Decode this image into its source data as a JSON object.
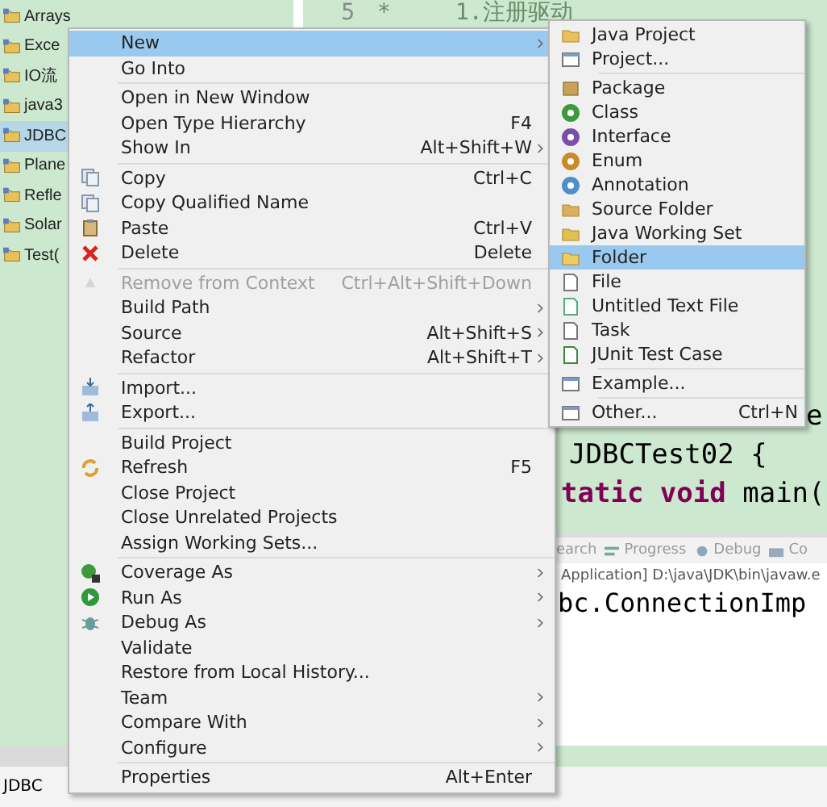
{
  "explorer": {
    "items": [
      {
        "label": "Arrays",
        "selected": false
      },
      {
        "label": "Exce",
        "selected": false
      },
      {
        "label": "IO流",
        "selected": false
      },
      {
        "label": "java3",
        "selected": false
      },
      {
        "label": "JDBC",
        "selected": true
      },
      {
        "label": "Plane",
        "selected": false
      },
      {
        "label": "Refle",
        "selected": false
      },
      {
        "label": "Solar",
        "selected": false
      },
      {
        "label": "Test(",
        "selected": false
      }
    ]
  },
  "editor": {
    "lines": [
      {
        "number": "5",
        "segments": [
          {
            "text": "*",
            "kind": "comment"
          },
          {
            "text": "1.注册驱动",
            "kind": "comment"
          }
        ]
      },
      {
        "segments": [
          {
            "text": "e",
            "kind": "plain"
          }
        ]
      },
      {
        "segments": [
          {
            "text": "JDBCTest02 {",
            "kind": "plain"
          }
        ]
      },
      {
        "segments": [
          {
            "text": "tatic void",
            "kind": "keyword"
          },
          {
            "text": " main(",
            "kind": "plain"
          }
        ]
      }
    ]
  },
  "console": {
    "tabs": [
      {
        "label": "earch",
        "kind": "search"
      },
      {
        "label": "Progress",
        "kind": "progress"
      },
      {
        "label": "Debug",
        "kind": "debug"
      },
      {
        "label": "Co",
        "kind": "console"
      }
    ],
    "header": "Application] D:\\java\\JDK\\bin\\javaw.e",
    "output": "bc.ConnectionImp"
  },
  "status_bar": {
    "text": "JDBC"
  },
  "context_menu": {
    "groups": [
      [
        {
          "label": "New",
          "selected": true,
          "submenu": true,
          "disabled": false
        },
        {
          "label": "Go Into",
          "selected": false,
          "submenu": false,
          "disabled": false
        }
      ],
      [
        {
          "label": "Open in New Window",
          "selected": false,
          "submenu": false,
          "disabled": false
        },
        {
          "label": "Open Type Hierarchy",
          "shortcut": "F4",
          "selected": false,
          "submenu": false,
          "disabled": false
        },
        {
          "label": "Show In",
          "shortcut": "Alt+Shift+W",
          "selected": false,
          "submenu": true,
          "disabled": false
        }
      ],
      [
        {
          "label": "Copy",
          "shortcut": "Ctrl+C",
          "kind": "copy",
          "selected": false,
          "submenu": false,
          "disabled": false
        },
        {
          "label": "Copy Qualified Name",
          "kind": "copy",
          "selected": false,
          "submenu": false,
          "disabled": false
        },
        {
          "label": "Paste",
          "shortcut": "Ctrl+V",
          "kind": "paste",
          "selected": false,
          "submenu": false,
          "disabled": false
        },
        {
          "label": "Delete",
          "shortcut": "Delete",
          "kind": "delete",
          "selected": false,
          "submenu": false,
          "disabled": false
        }
      ],
      [
        {
          "label": "Remove from Context",
          "shortcut": "Ctrl+Alt+Shift+Down",
          "kind": "remove",
          "selected": false,
          "submenu": false,
          "disabled": true
        },
        {
          "label": "Build Path",
          "selected": false,
          "submenu": true,
          "disabled": false
        },
        {
          "label": "Source",
          "shortcut": "Alt+Shift+S",
          "selected": false,
          "submenu": true,
          "disabled": false
        },
        {
          "label": "Refactor",
          "shortcut": "Alt+Shift+T",
          "selected": false,
          "submenu": true,
          "disabled": false
        }
      ],
      [
        {
          "label": "Import...",
          "kind": "import",
          "selected": false,
          "submenu": false,
          "disabled": false
        },
        {
          "label": "Export...",
          "kind": "export",
          "selected": false,
          "submenu": false,
          "disabled": false
        }
      ],
      [
        {
          "label": "Build Project",
          "selected": false,
          "submenu": false,
          "disabled": false
        },
        {
          "label": "Refresh",
          "shortcut": "F5",
          "kind": "refresh",
          "selected": false,
          "submenu": false,
          "disabled": false
        },
        {
          "label": "Close Project",
          "selected": false,
          "submenu": false,
          "disabled": false
        },
        {
          "label": "Close Unrelated Projects",
          "selected": false,
          "submenu": false,
          "disabled": false
        },
        {
          "label": "Assign Working Sets...",
          "selected": false,
          "submenu": false,
          "disabled": false
        }
      ],
      [
        {
          "label": "Coverage As",
          "kind": "coverage",
          "selected": false,
          "submenu": true,
          "disabled": false
        },
        {
          "label": "Run As",
          "kind": "run",
          "selected": false,
          "submenu": true,
          "disabled": false
        },
        {
          "label": "Debug As",
          "kind": "debug",
          "selected": false,
          "submenu": true,
          "disabled": false
        },
        {
          "label": "Validate",
          "selected": false,
          "submenu": false,
          "disabled": false
        },
        {
          "label": "Restore from Local History...",
          "selected": false,
          "submenu": false,
          "disabled": false
        },
        {
          "label": "Team",
          "selected": false,
          "submenu": true,
          "disabled": false
        },
        {
          "label": "Compare With",
          "selected": false,
          "submenu": true,
          "disabled": false
        },
        {
          "label": "Configure",
          "selected": false,
          "submenu": true,
          "disabled": false
        }
      ],
      [
        {
          "label": "Properties",
          "shortcut": "Alt+Enter",
          "selected": false,
          "submenu": false,
          "disabled": false
        }
      ]
    ]
  },
  "submenu": {
    "groups": [
      [
        {
          "label": "Java Project",
          "kind": "java-project",
          "selected": false
        },
        {
          "label": "Project...",
          "kind": "window",
          "selected": false
        }
      ],
      [
        {
          "label": "Package",
          "kind": "package",
          "selected": false
        },
        {
          "label": "Class",
          "kind": "class",
          "selected": false
        },
        {
          "label": "Interface",
          "kind": "interface",
          "selected": false
        },
        {
          "label": "Enum",
          "kind": "enum",
          "selected": false
        },
        {
          "label": "Annotation",
          "kind": "annotation",
          "selected": false
        },
        {
          "label": "Source Folder",
          "kind": "source-folder",
          "selected": false
        },
        {
          "label": "Java Working Set",
          "kind": "working-set",
          "selected": false
        },
        {
          "label": "Folder",
          "kind": "folder",
          "selected": true
        },
        {
          "label": "File",
          "kind": "file",
          "selected": false
        },
        {
          "label": "Untitled Text File",
          "kind": "text-file",
          "selected": false
        },
        {
          "label": "Task",
          "kind": "file",
          "selected": false
        },
        {
          "label": "JUnit Test Case",
          "kind": "junit",
          "selected": false
        }
      ],
      [
        {
          "label": "Example...",
          "kind": "window",
          "selected": false
        }
      ],
      [
        {
          "label": "Other...",
          "shortcut": "Ctrl+N",
          "kind": "window",
          "selected": false
        }
      ]
    ]
  }
}
